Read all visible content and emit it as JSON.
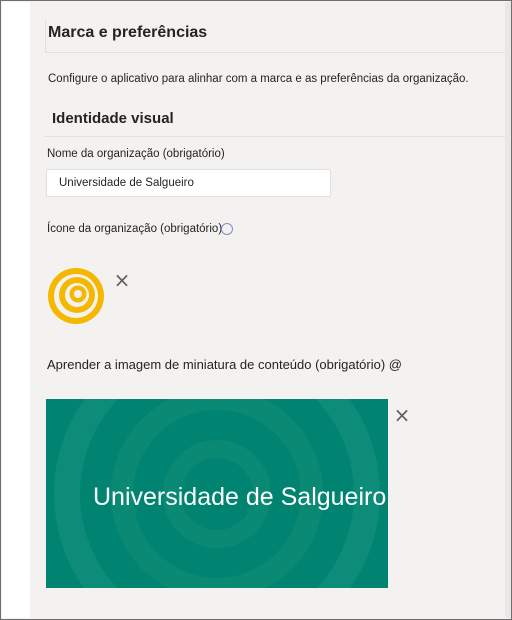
{
  "page": {
    "title": "Marca e preferências",
    "description": "Configure o aplicativo para alinhar com a marca e as preferências da organização."
  },
  "visual_identity": {
    "section_title": "Identidade visual",
    "org_name": {
      "label": "Nome da organização (obrigatório)",
      "value": "Universidade de Salgueiro"
    },
    "org_icon": {
      "label": "Ícone da organização (obrigatório)",
      "info_icon": "info-icon",
      "logo_icon": "concentric-rings-logo",
      "logo_color": "#f5b800",
      "remove_label": "×"
    },
    "thumbnail": {
      "label": "Aprender a imagem de miniatura de conteúdo (obrigatório) @",
      "text": "Universidade de Salgueiro",
      "background_color": "#008471",
      "remove_label": "×"
    }
  }
}
